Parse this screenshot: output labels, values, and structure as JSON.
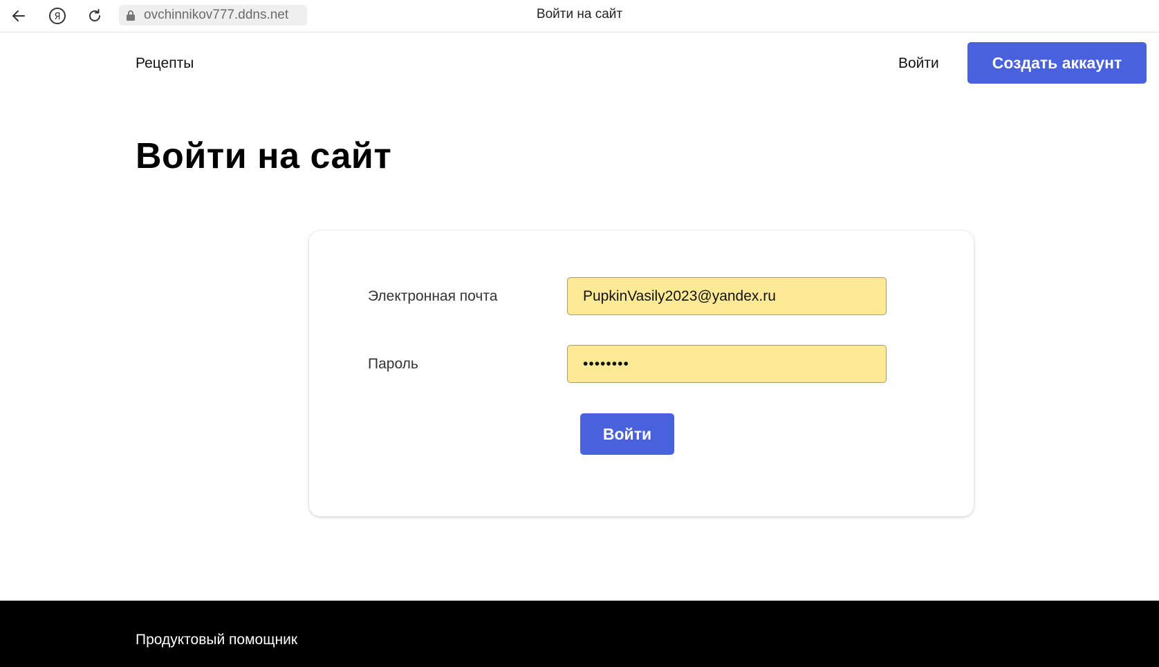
{
  "browser": {
    "url": "ovchinnikov777.ddns.net",
    "tab_title": "Войти на сайт",
    "icons": [
      "back-arrow-icon",
      "yandex-icon",
      "reload-icon",
      "lock-icon"
    ]
  },
  "header": {
    "nav_recipes": "Рецепты",
    "nav_login": "Войти",
    "create_account": "Создать аккаунт"
  },
  "page": {
    "title": "Войти на сайт"
  },
  "form": {
    "email_label": "Электронная почта",
    "email_value": "PupkinVasily2023@yandex.ru",
    "password_label": "Пароль",
    "password_value": "••••••••",
    "submit_label": "Войти"
  },
  "footer": {
    "text": "Продуктовый помощник"
  },
  "colors": {
    "accent": "#4a61dd",
    "autofill": "#fee995",
    "footer_bg": "#000000"
  }
}
